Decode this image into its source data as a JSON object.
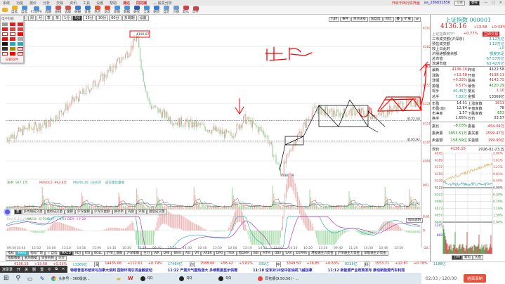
{
  "menubar": {
    "items": [
      "系统",
      "功能",
      "报价",
      "分析",
      "交易",
      "资讯",
      "工具",
      "设置",
      "帮助"
    ],
    "brand": "通达",
    "app_title": "同花顺",
    "subtitle": "— 股票分析",
    "right_user": "开启千档行情界面",
    "user_id": "aa_286832856",
    "btn1": "交易",
    "btn2": "委托"
  },
  "toolbar": {
    "items": [
      "",
      "自选",
      "自选",
      "F10/F9",
      "周期",
      "画线",
      "选股",
      "研报",
      "资金",
      "热点",
      "龙虎",
      "新股",
      "数据",
      "研究",
      "全球",
      "期货",
      "自定",
      "沙盘",
      "默认",
      "DTF"
    ]
  },
  "periods": [
    "日",
    "周",
    "月",
    "季",
    "年",
    "1分",
    "5分",
    "15分",
    "30分",
    "60分",
    "多周期",
    "设置"
  ],
  "period_active": "5分",
  "top_right_tabs": [
    "九转",
    "事件",
    "热点讯号",
    "加自选",
    "对比",
    "叠",
    "扩展",
    "⏭"
  ],
  "drawtools": {
    "title": "电子刻板",
    "footer": "已锁软件"
  },
  "price_axis": [
    "4197",
    "4182",
    "4166",
    "4151",
    "4136",
    "4120",
    "4105",
    "4090"
  ],
  "chart_labels": {
    "high": "4190.87",
    "low": "4080.29",
    "ref1": "4122.58",
    "ref2": "4105.92"
  },
  "volume": {
    "legend_main": "总手: 927.1万",
    "legend_ma5": "MAVOL5: 992.8万",
    "legend_ma10": "MAVOL10: 1040万",
    "legend_extra": "成交量比量收",
    "axis": [
      "801"
    ]
  },
  "vol_tabs": [
    "量",
    "多周期成交量",
    "虚拟成交量",
    "金额",
    "沪深金额",
    "沪深京金额",
    "换手率",
    "内盘",
    "外盘",
    "盘后成交量"
  ],
  "macd": {
    "legend_param": "MACD(12,26,9)",
    "legend_macd": "MACD: -0.704",
    "legend_diff": "DIFF: +6.63",
    "legend_dea": "DEA: +7.28",
    "axis": [
      "8.61",
      "0",
      "-10.74"
    ],
    "btn": "指标说明"
  },
  "time_axis": [
    "09:50",
    "10:40",
    "13:50",
    "10:00",
    "13:10",
    "14:50",
    "11:00",
    "14:10",
    "10:20",
    "13:30",
    "09:40",
    "11:20",
    "14:30",
    "10:40",
    "13:50",
    "10:00",
    "13:10",
    "14:50",
    "11:00",
    "14:10",
    "10:20",
    "13:30",
    "09:40",
    "11:20",
    "14:30",
    "10:40",
    "13:50"
  ],
  "indicator_tabs": [
    "指标",
    "MAVI",
    "指标广场",
    "☆ 自选",
    "MACD",
    "KDJ",
    "RSI",
    "BOLL",
    "沪深上涨数",
    "沪深家数",
    "主力",
    "WR",
    "DMI",
    "BIAS",
    "ASI",
    "VR",
    "ARBR",
    "DPO",
    "TRIX",
    "指DMA",
    "BBI",
    "MTM",
    "OBV",
    "SAR",
    "EXPMA",
    "港股通主力资金",
    "沪深通主力资金",
    "深股通主力资金"
  ],
  "indicator_active": "MACD",
  "sub_tabs": [
    "指数数据",
    "板块数据",
    "资金机构",
    "论文"
  ],
  "right": {
    "title": "上证指数 000001",
    "price": "4136.16",
    "chg": "+13.58",
    "pct": "+0.33%",
    "etf_label": "上证指数ETF*",
    "etf_pct": "+0.77%",
    "etf_btn": "立即交易",
    "info": [
      [
        "三市成交额(沪深京)",
        "3.12万亿"
      ],
      [
        "预估成交额",
        "3.12万亿"
      ],
      [
        "较上日此时",
        "+0"
      ],
      [
        "沪股通额度余额",
        "额度充足"
      ],
      [
        "总市值",
        "67.57万亿"
      ],
      [
        "流通市值",
        "63.42万亿"
      ]
    ],
    "quote": [
      [
        "最新",
        "4136.16",
        "昨收",
        "4122.58"
      ],
      [
        "涨跌",
        "+13.58",
        "开盘",
        "4138.11"
      ],
      [
        "涨幅",
        "+0.33%",
        "最高",
        "4143.75"
      ],
      [
        "振幅",
        "0.57%",
        "最低",
        "4120.29"
      ],
      [
        "现手",
        "40.45万",
        "量比",
        "1.10"
      ],
      [
        "总手",
        "7.82亿",
        "金额",
        "13369亿"
      ]
    ],
    "stats": [
      [
        "市盈",
        "14.31",
        "上涨家数",
        "1613"
      ],
      [
        "市盈(动)",
        "12.84",
        "平盘家数",
        "78"
      ],
      [
        "市净率",
        "1.57",
        "下跌家数",
        "653"
      ],
      [
        "换手",
        "1.65%",
        "均价",
        "33.57"
      ]
    ],
    "order": [
      [
        "委比",
        "-8.03%",
        "委差",
        "-454.04万"
      ],
      [
        "委卖量",
        "3953.51万",
        "委买量",
        "2599.47万"
      ],
      [
        "卖金额",
        "158.59亿",
        "买金额",
        "199.90亿"
      ]
    ],
    "mini_head": [
      "现价",
      "4136.16",
      "2026-01-23,五"
    ],
    "mini_left": [
      "4205",
      "4189",
      "4172",
      "4156",
      "4139",
      "4123",
      "4107",
      "4090",
      "4073",
      "4057",
      "4040"
    ],
    "mini_right": [
      "2.00%",
      "1.61%",
      "1.21%",
      "0.81%",
      "0.40%",
      "0.00%",
      "0.39%",
      "0.79%",
      "1.19%",
      "1.59%",
      "2.00%"
    ],
    "mini_vol": [
      "1205",
      "868"
    ],
    "bottom_tabs": [
      "分时",
      "筹码",
      "大盘"
    ]
  },
  "ticker": [
    [
      "",
      "4136.16",
      "+13.58",
      "+0.33%",
      "13369亿"
    ],
    [
      "深",
      "14435.66",
      "+112.61",
      "+0.79%",
      "17464亿"
    ],
    [
      "创",
      "1588.66",
      "+58.42",
      "+3.82%",
      "331亿"
    ],
    [
      "中",
      "3349.50",
      "+26.85",
      "+0.83%",
      "8228亿"
    ],
    [
      "科",
      "1553.71",
      "+12.87",
      "+0.78%",
      "1188亿"
    ]
  ],
  "news": [
    "特朗普宣布结束与加拿大谈判 国际环境引发金融波动",
    "11:22 产業天气图热涨大 多维数据显示供需",
    "11:18 空军对10空中加油机飞越加拿",
    "11:12 新能源产业政策发布 推动新能源汽车利润"
  ],
  "rectool": [
    "滞录录",
    "开",
    "关",
    "删",
    "置",
    "◎",
    "⧉",
    "✕"
  ],
  "taskbar": {
    "items": [
      "头条号 - 360极速...",
      "QQ",
      "QQ",
      "QQ",
      "同花顺(9:50:50) - ..."
    ],
    "timer": "02:03",
    "timer_total": "/ 120:00",
    "stop_btn": "结束录制"
  },
  "colors": {
    "up": "#dd2222",
    "down": "#119911",
    "teal": "#1a9a9a",
    "annotation": "#ff0000"
  }
}
